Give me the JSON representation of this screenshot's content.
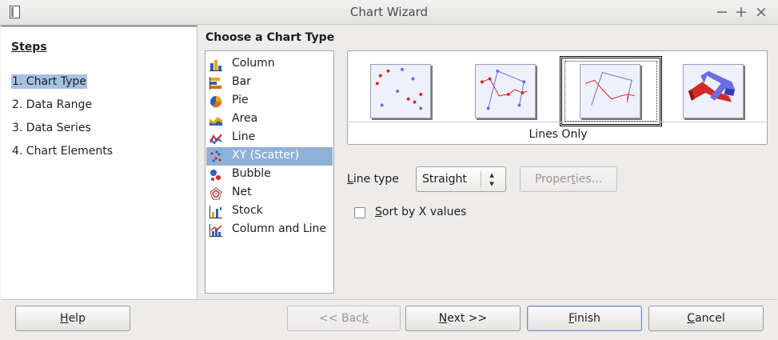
{
  "window": {
    "title": "Chart Wizard",
    "controls": [
      "−",
      "+",
      "×"
    ]
  },
  "steps": {
    "heading": "Steps",
    "items": [
      {
        "label": "1. Chart Type",
        "active": true
      },
      {
        "label": "2. Data Range",
        "active": false
      },
      {
        "label": "3. Data Series",
        "active": false
      },
      {
        "label": "4. Chart Elements",
        "active": false
      }
    ]
  },
  "chart_type": {
    "heading": "Choose a Chart Type",
    "types": [
      {
        "label": "Column",
        "icon": "column-chart-icon"
      },
      {
        "label": "Bar",
        "icon": "bar-chart-icon"
      },
      {
        "label": "Pie",
        "icon": "pie-chart-icon"
      },
      {
        "label": "Area",
        "icon": "area-chart-icon"
      },
      {
        "label": "Line",
        "icon": "line-chart-icon"
      },
      {
        "label": "XY (Scatter)",
        "icon": "scatter-chart-icon",
        "selected": true
      },
      {
        "label": "Bubble",
        "icon": "bubble-chart-icon"
      },
      {
        "label": "Net",
        "icon": "net-chart-icon"
      },
      {
        "label": "Stock",
        "icon": "stock-chart-icon"
      },
      {
        "label": "Column and Line",
        "icon": "column-line-chart-icon"
      }
    ],
    "variants": [
      {
        "name": "points-only-icon"
      },
      {
        "name": "points-and-lines-icon"
      },
      {
        "name": "lines-only-icon",
        "selected": true
      },
      {
        "name": "3d-lines-icon"
      }
    ],
    "selected_variant_caption": "Lines Only"
  },
  "options": {
    "line_type_label_prefix": "L",
    "line_type_label_rest": "ine type",
    "line_type_value": "Straight",
    "properties_button_pre": "Proper",
    "properties_button_u": "t",
    "properties_button_post": "ies...",
    "sort_label_prefix": "S",
    "sort_label_rest": "ort by X values",
    "sort_checked": false
  },
  "buttons": {
    "help_u": "H",
    "help_rest": "elp",
    "back_pre": "<< Bac",
    "back_u": "k",
    "next_u": "N",
    "next_rest": "ext >>",
    "finish_u": "F",
    "finish_rest": "inish",
    "cancel_u": "C",
    "cancel_rest": "ancel"
  },
  "colors": {
    "selection": "#8fb0d9",
    "step_active": "#a5c1e4",
    "series_red": "#e02020",
    "series_blue": "#5a5ae0"
  }
}
